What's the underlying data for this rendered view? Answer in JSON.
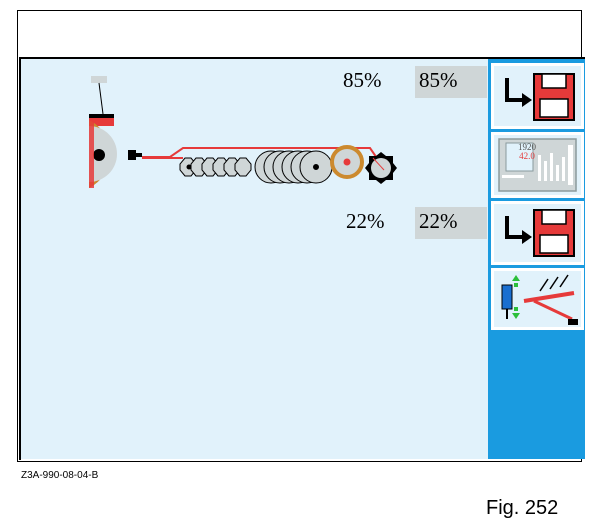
{
  "screen": {
    "upper_value": "85%",
    "upper_value_box": "85%",
    "lower_value": "22%",
    "lower_value_box": "22%"
  },
  "sidebar": {
    "buttons": [
      {
        "icon": "save-disk-icon"
      },
      {
        "icon": "control-panel-icon",
        "panel_top": "1920",
        "panel_bottom": "42.0"
      },
      {
        "icon": "save-disk-icon"
      },
      {
        "icon": "hydraulic-implement-icon"
      }
    ]
  },
  "caption": "Z3A-990-08-04-B",
  "figure_label": "Fig. 252",
  "colors": {
    "screen_bg": "#e1f2fb",
    "sidebar_bg": "#1a9be0",
    "value_box_bg": "#cfd6d7",
    "accent_red": "#e63a3a",
    "wheel_orange": "#cc8a2e"
  }
}
